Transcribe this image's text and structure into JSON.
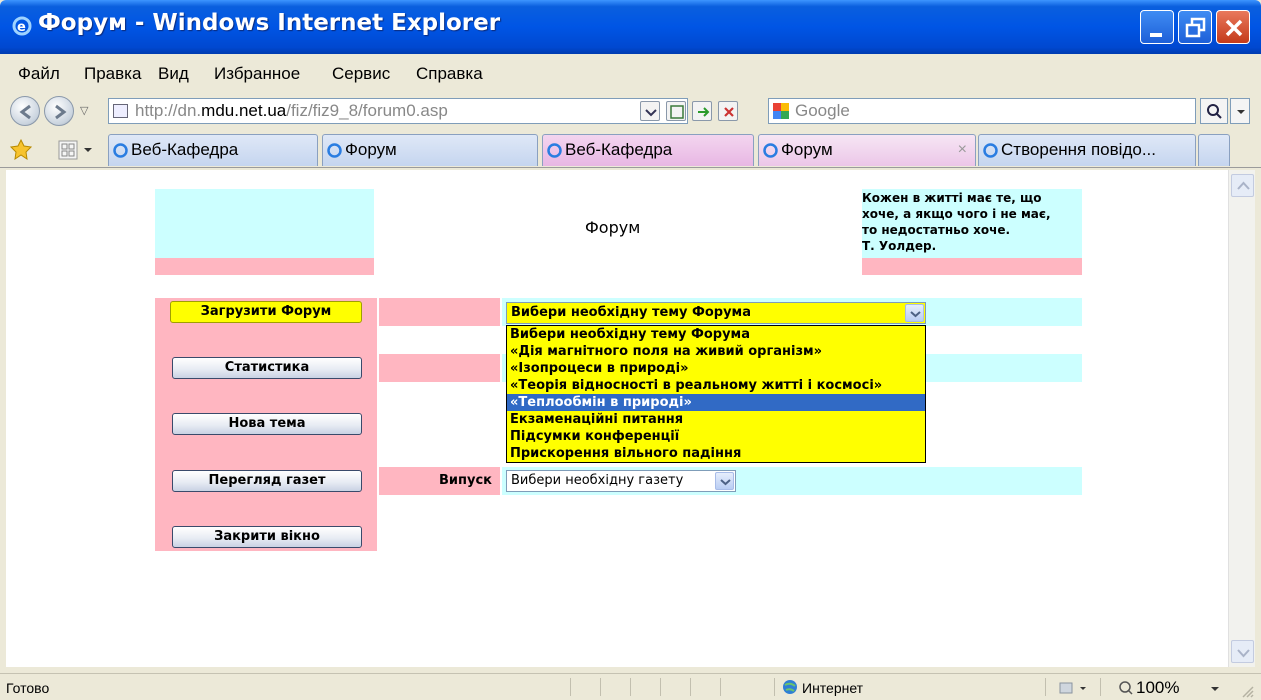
{
  "window": {
    "title": "Форум - Windows Internet Explorer"
  },
  "menu": [
    "Файл",
    "Правка",
    "Вид",
    "Избранное",
    "Сервис",
    "Справка"
  ],
  "address": {
    "url_prefix": "http://dn.",
    "url_host": "mdu.net.ua",
    "url_path": "/fiz/fiz9_8/forum0.asp",
    "search_placeholder": "Google"
  },
  "tabs": [
    {
      "label": "Веб-Кафедра",
      "color": "blue"
    },
    {
      "label": "Форум",
      "color": "blue"
    },
    {
      "label": "Веб-Кафедра",
      "color": "pink"
    },
    {
      "label": "Форум",
      "color": "active"
    },
    {
      "label": "Створення повідо...",
      "color": "blue"
    }
  ],
  "page": {
    "header_title": "Форум",
    "quote": "Кожен в житті має те, що\nхоче, а якщо чого і не має,\nто недостатньо хоче.\nТ. Уолдер.",
    "buttons": {
      "load_forum": "Загрузити Форум",
      "statistics": "Статистика",
      "new_topic": "Нова тема",
      "view_newspapers": "Перегляд газет",
      "close_window": "Закрити вікно"
    },
    "topic_select": {
      "value": "Вибери необхідну тему Форума",
      "options": [
        "Вибери необхідну тему Форума",
        "«Дія магнітного поля на живий організм»",
        "«Ізопроцеси в природі»",
        "«Теорія відносності в реальному житті і космосі»",
        "«Теплообмін в природі»",
        "Екзаменаційні питання",
        "Підсумки конференції",
        "Прискорення вільного падіння"
      ],
      "highlighted_index": 4
    },
    "issue_label": "Випуск",
    "newspaper_select": {
      "value": "Вибери необхідну газету"
    }
  },
  "status": {
    "left": "Готово",
    "zone": "Интернет",
    "zoom": "100%"
  },
  "colors": {
    "cyan_cell": "#ccffff",
    "pink_cell": "#ffb6c1",
    "yellow": "#ffff00",
    "highlight": "#316ac5"
  }
}
